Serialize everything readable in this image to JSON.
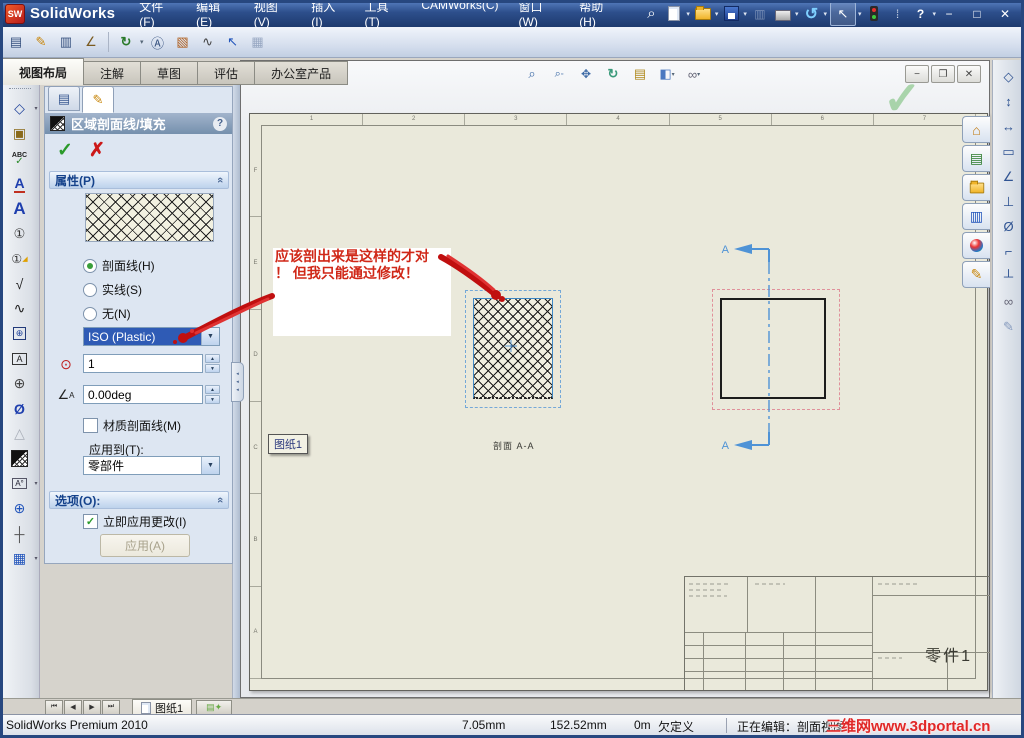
{
  "titlebar": {
    "logo_text": "SW",
    "app_name": "SolidWorks",
    "menus": [
      "文件(F)",
      "编辑(E)",
      "视图(V)",
      "插入(I)",
      "工具(T)",
      "CAMWorks(C)",
      "窗口(W)",
      "帮助(H)"
    ]
  },
  "command_tabs": [
    "视图布局",
    "注解",
    "草图",
    "评估",
    "办公室产品"
  ],
  "property_manager": {
    "title": "区域剖面线/填充",
    "help_label": "?",
    "properties": {
      "header": "属性(P)",
      "radio_hatch": "剖面线(H)",
      "radio_solid": "实线(S)",
      "radio_none": "无(N)",
      "pattern_value": "ISO (Plastic)",
      "scale_value": "1",
      "angle_value": "0.00deg",
      "material_checkbox_label": "材质剖面线(M)",
      "apply_to_label": "应用到(T):",
      "apply_to_value": "零部件"
    },
    "options": {
      "header": "选项(O):",
      "apply_immediately_label": "立即应用更改(I)",
      "apply_button_label": "应用(A)"
    }
  },
  "drawing": {
    "note_line1": "应该剖出来是这样的才对",
    "note_line2": "！ 但我只能通过修改！",
    "sheet_tag": "图纸1",
    "section_view_label": "剖面 A-A",
    "section_arrow_label": "A",
    "title_block_part_name": "零件1",
    "zone_numbers": [
      "1",
      "2",
      "3",
      "4",
      "5",
      "6",
      "7"
    ],
    "zone_letters": [
      "F",
      "E",
      "D",
      "C",
      "B",
      "A"
    ]
  },
  "sheet_bar": {
    "sheet_tab_label": "图纸1"
  },
  "status_bar": {
    "app_version": "SolidWorks Premium 2010",
    "coord_x": "7.05mm",
    "coord_y": "152.52mm",
    "coord_z": "0m",
    "constraint_state": "欠定义",
    "editing_status": "正在编辑：剖面视图",
    "watermark": "三维网www.3dportal.cn"
  },
  "toolbars": {
    "quick_access": [
      "search",
      "new",
      "open",
      "save",
      "make-from-part",
      "print",
      "undo",
      "select",
      "camworks-stoplight",
      "rebuild",
      "help"
    ],
    "drawing_toolbar": [
      "sheet-format",
      "edit-sketch",
      "standard-3-view",
      "projected-view",
      "update-view",
      "note-format",
      "image",
      "spline",
      "select-tool",
      "table-disabled"
    ],
    "annotation_toolbar": [
      "smart-dimension",
      "model-items",
      "spell-checker",
      "format-painter",
      "note",
      "balloon",
      "auto-balloon",
      "surface-finish",
      "weld-symbol",
      "geometric-tolerance",
      "datum-feature",
      "datum-target",
      "hole-callout",
      "revision-symbol",
      "area-hatch-fill",
      "blocks",
      "center-mark",
      "centerline",
      "tables"
    ],
    "heads_up": [
      "zoom-to-fit",
      "zoom-to-area",
      "pan",
      "rotate-view",
      "redraw",
      "display-style",
      "hide-show-items"
    ],
    "task_pane": [
      "home",
      "design-library",
      "file-explorer",
      "view-palette",
      "appearances",
      "custom-properties"
    ]
  }
}
